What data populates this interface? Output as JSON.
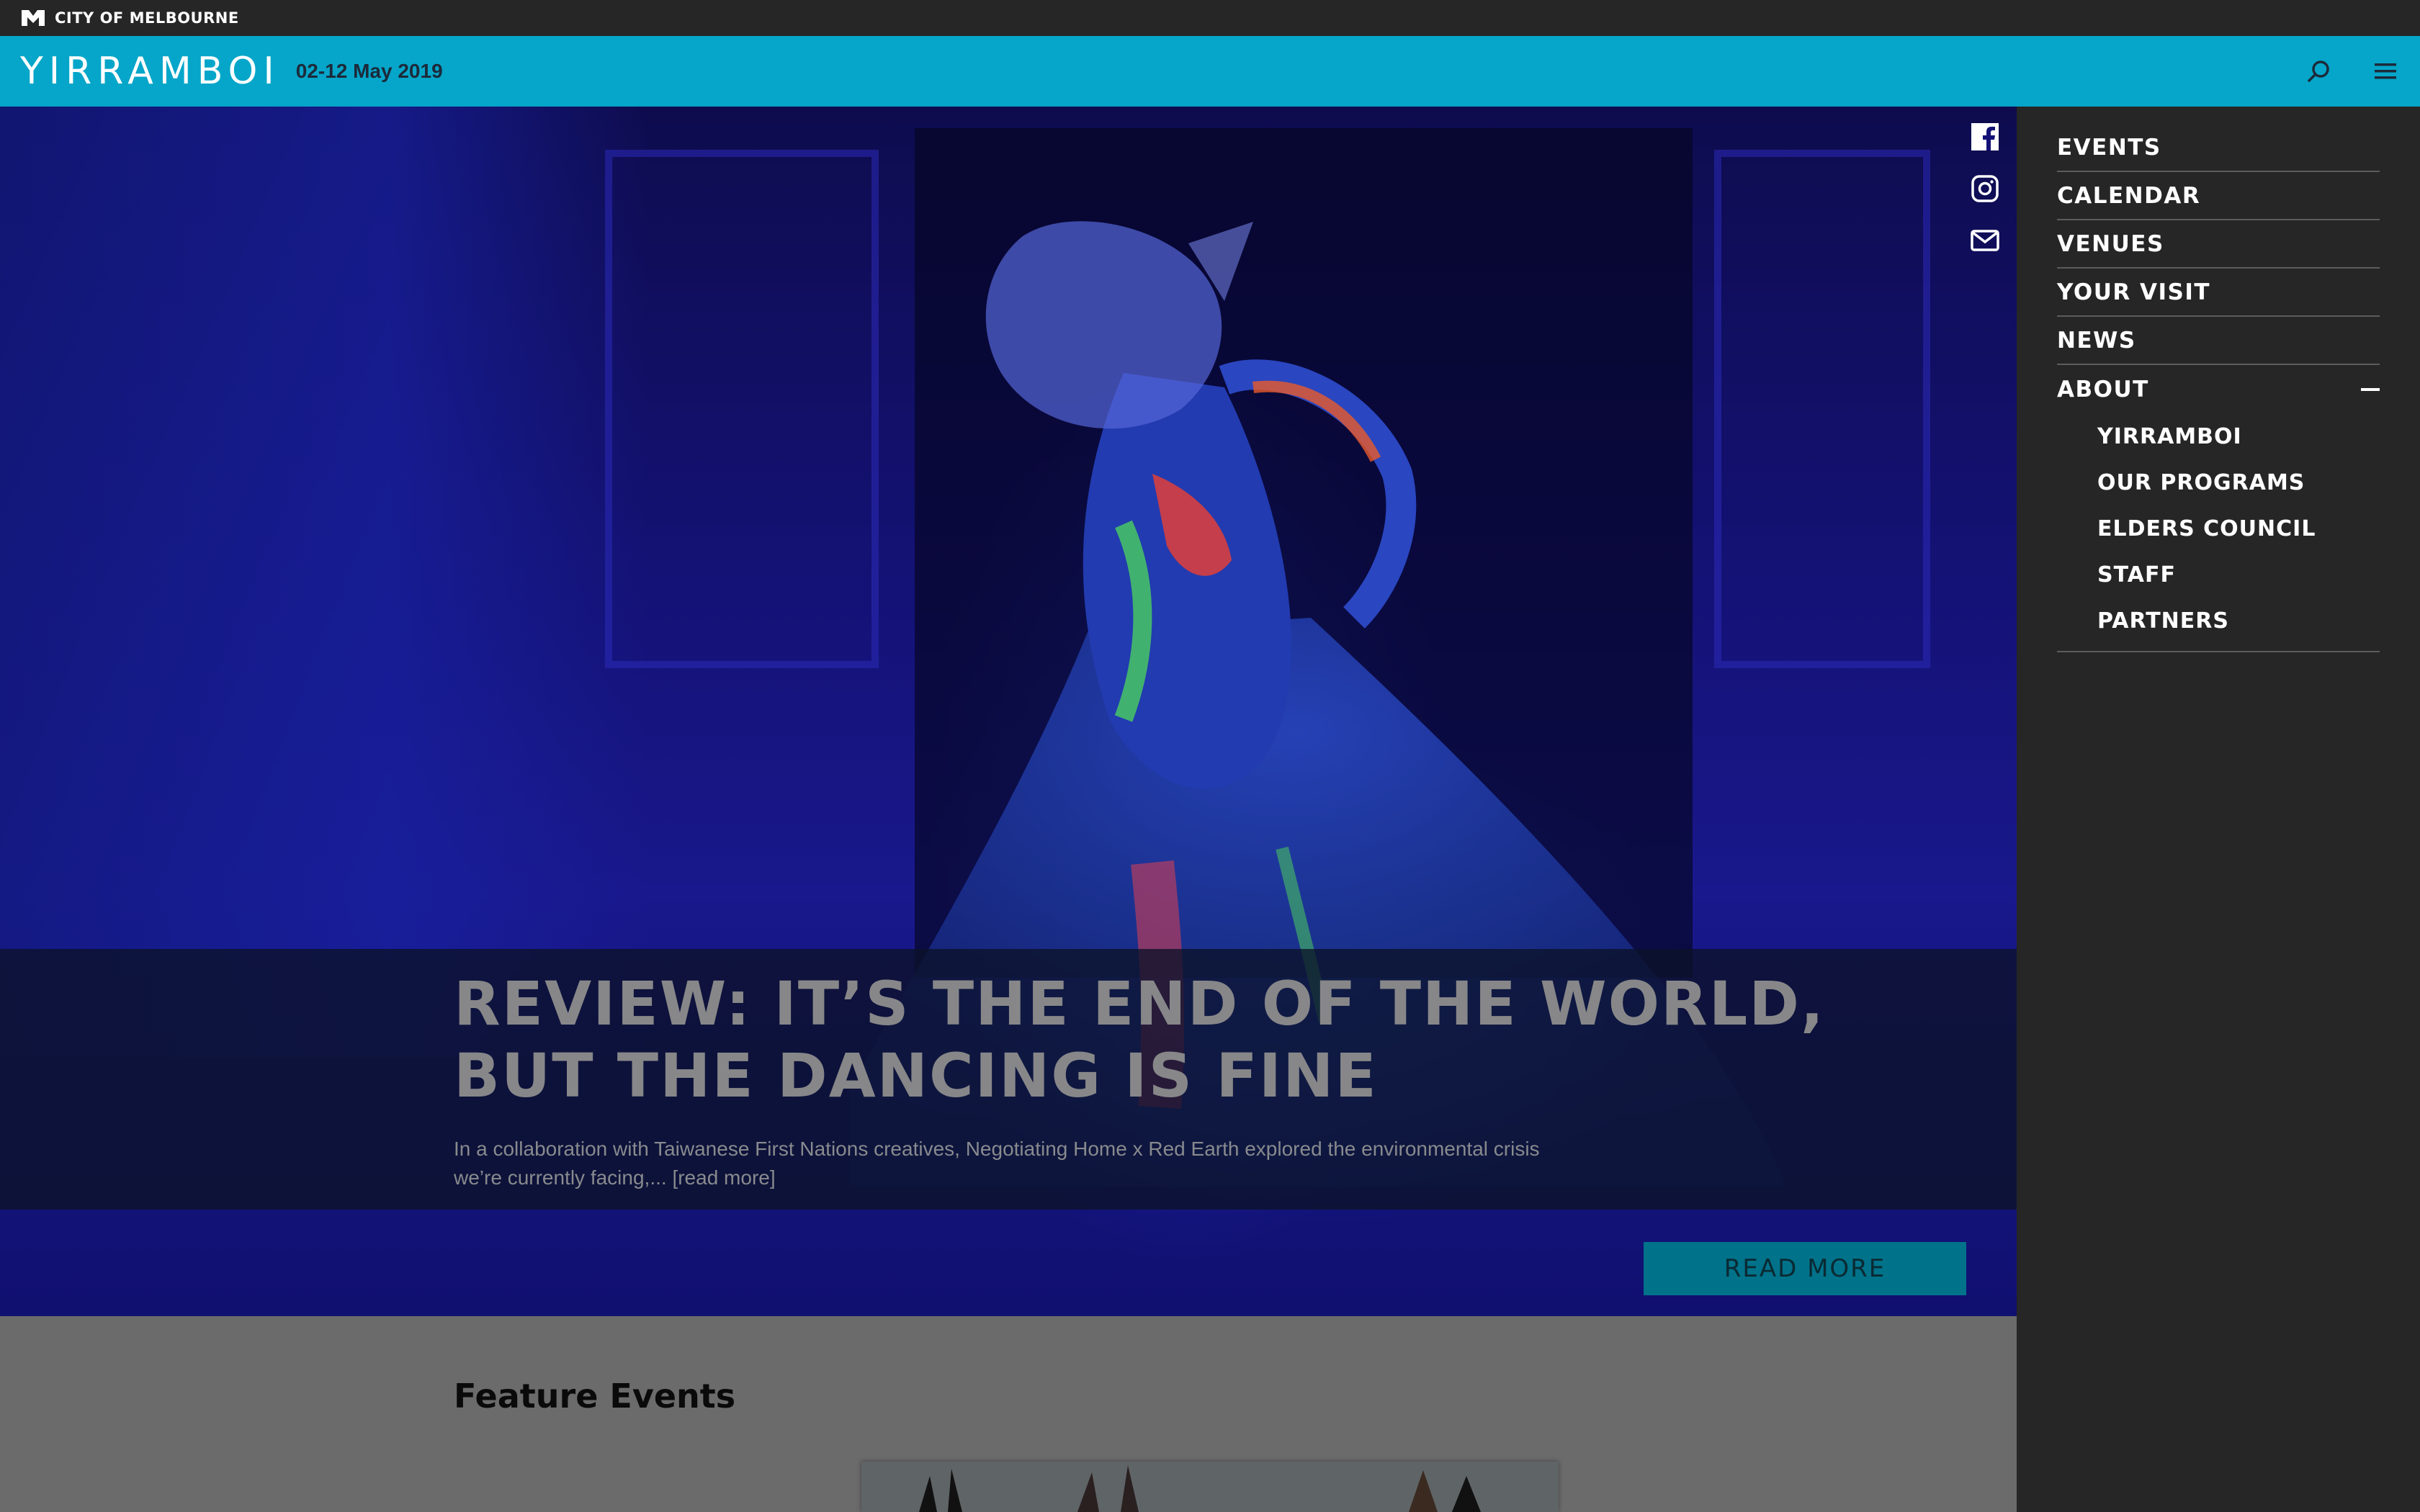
{
  "topbar": {
    "org_name": "CITY OF MELBOURNE"
  },
  "header": {
    "brand": "YIRRAMBOI",
    "dates": "02-12 May 2019"
  },
  "hero": {
    "title": "REVIEW: IT’S THE END OF THE WORLD, BUT THE DANCING IS FINE",
    "excerpt": "In a collaboration with Taiwanese First Nations creatives, Negotiating Home x Red Earth explored the environmental crisis we’re currently facing,... [read more]",
    "cta_label": "READ MORE"
  },
  "social": [
    "facebook-icon",
    "instagram-icon",
    "mail-icon"
  ],
  "feature": {
    "title": "Feature Events"
  },
  "nav": {
    "items": [
      {
        "label": "EVENTS"
      },
      {
        "label": "CALENDAR"
      },
      {
        "label": "VENUES"
      },
      {
        "label": "YOUR VISIT"
      },
      {
        "label": "NEWS"
      },
      {
        "label": "ABOUT",
        "expanded": true
      }
    ],
    "about_children": [
      {
        "label": "YIRRAMBOI"
      },
      {
        "label": "OUR PROGRAMS"
      },
      {
        "label": "ELDERS COUNCIL"
      },
      {
        "label": "STAFF"
      },
      {
        "label": "PARTNERS"
      }
    ]
  },
  "colors": {
    "brand_cyan": "#05a6c9",
    "dark_bar": "#262626",
    "cta_teal": "#00728a"
  }
}
